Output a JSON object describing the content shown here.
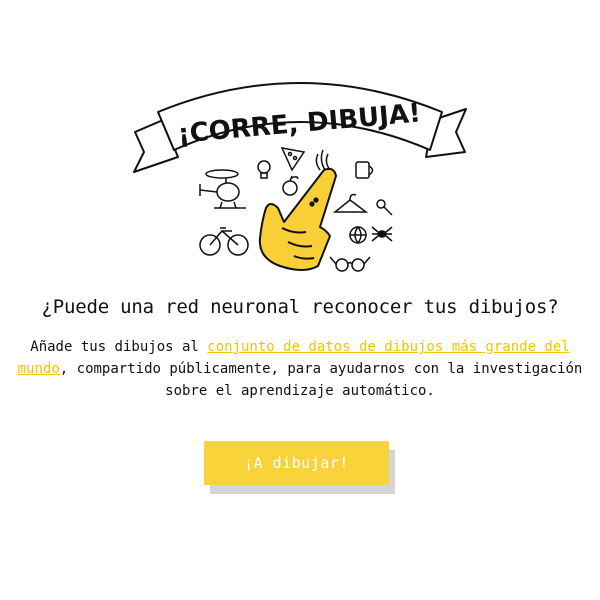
{
  "banner": {
    "title": "¡CORRE, DIBUJA!"
  },
  "headline": "¿Puede una red neuronal reconocer tus dibujos?",
  "description": {
    "line1_prefix": "Añade tus dibujos al ",
    "link_part1": "conjunto de datos de dibujos más grande del",
    "link_part2": "mundo",
    "line2_suffix": ", compartido públicamente, para ayudarnos con la investigación",
    "line3": "sobre el aprendizaje automático."
  },
  "cta": {
    "label": "¡A dibujar!"
  },
  "colors": {
    "accent": "#f8d33a",
    "link": "#f4c400",
    "text": "#111111"
  },
  "doodles": [
    "helicopter-icon",
    "lightbulb-icon",
    "pizza-icon",
    "apple-icon",
    "steam-icon",
    "mug-icon",
    "hanger-icon",
    "pushpin-icon",
    "bicycle-icon",
    "basketball-icon",
    "spider-icon",
    "eyeglasses-icon",
    "pointing-hand-icon"
  ]
}
